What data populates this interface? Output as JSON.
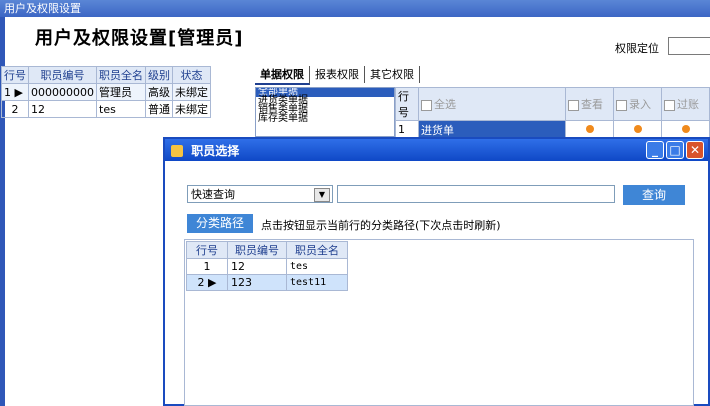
{
  "window": {
    "title": "用户及权限设置"
  },
  "page": {
    "title": "用户及权限设置[管理员]",
    "locate_label": "权限定位"
  },
  "users": {
    "columns": [
      "行号",
      "职员编号",
      "职员全名",
      "级别",
      "状态"
    ],
    "rows": [
      {
        "num": "1",
        "marker": "▶",
        "code": "000000000",
        "name": "管理员",
        "level": "高级",
        "status": "未绑定"
      },
      {
        "num": "2",
        "marker": "",
        "code": "12",
        "name": "tes",
        "level": "普通",
        "status": "未绑定"
      }
    ]
  },
  "tabs": [
    "单据权限",
    "报表权限",
    "其它权限"
  ],
  "doc_categories": [
    "全部单据",
    "进货类单据",
    "销售类单据",
    "库存类单据"
  ],
  "permissions": {
    "columns": [
      "行号",
      "全选",
      "查看",
      "录入",
      "过账"
    ],
    "rows": [
      {
        "num": "1",
        "name": "进货单"
      }
    ]
  },
  "dialog": {
    "title": "职员选择",
    "query_select": "快速查询",
    "query_button": "查询",
    "path_button": "分类路径",
    "path_hint": "点击按钮显示当前行的分类路径(下次点击时刷新)",
    "columns": [
      "行号",
      "职员编号",
      "职员全名"
    ],
    "rows": [
      {
        "num": "1",
        "marker": "",
        "code": "12",
        "name": "tes"
      },
      {
        "num": "2",
        "marker": "▶",
        "code": "123",
        "name": "test11"
      }
    ]
  },
  "colors": {
    "accent": "#3f86d6",
    "titlebar": "#0f48c6",
    "selection": "#2b5dbc",
    "dot": "#f08a1c"
  }
}
